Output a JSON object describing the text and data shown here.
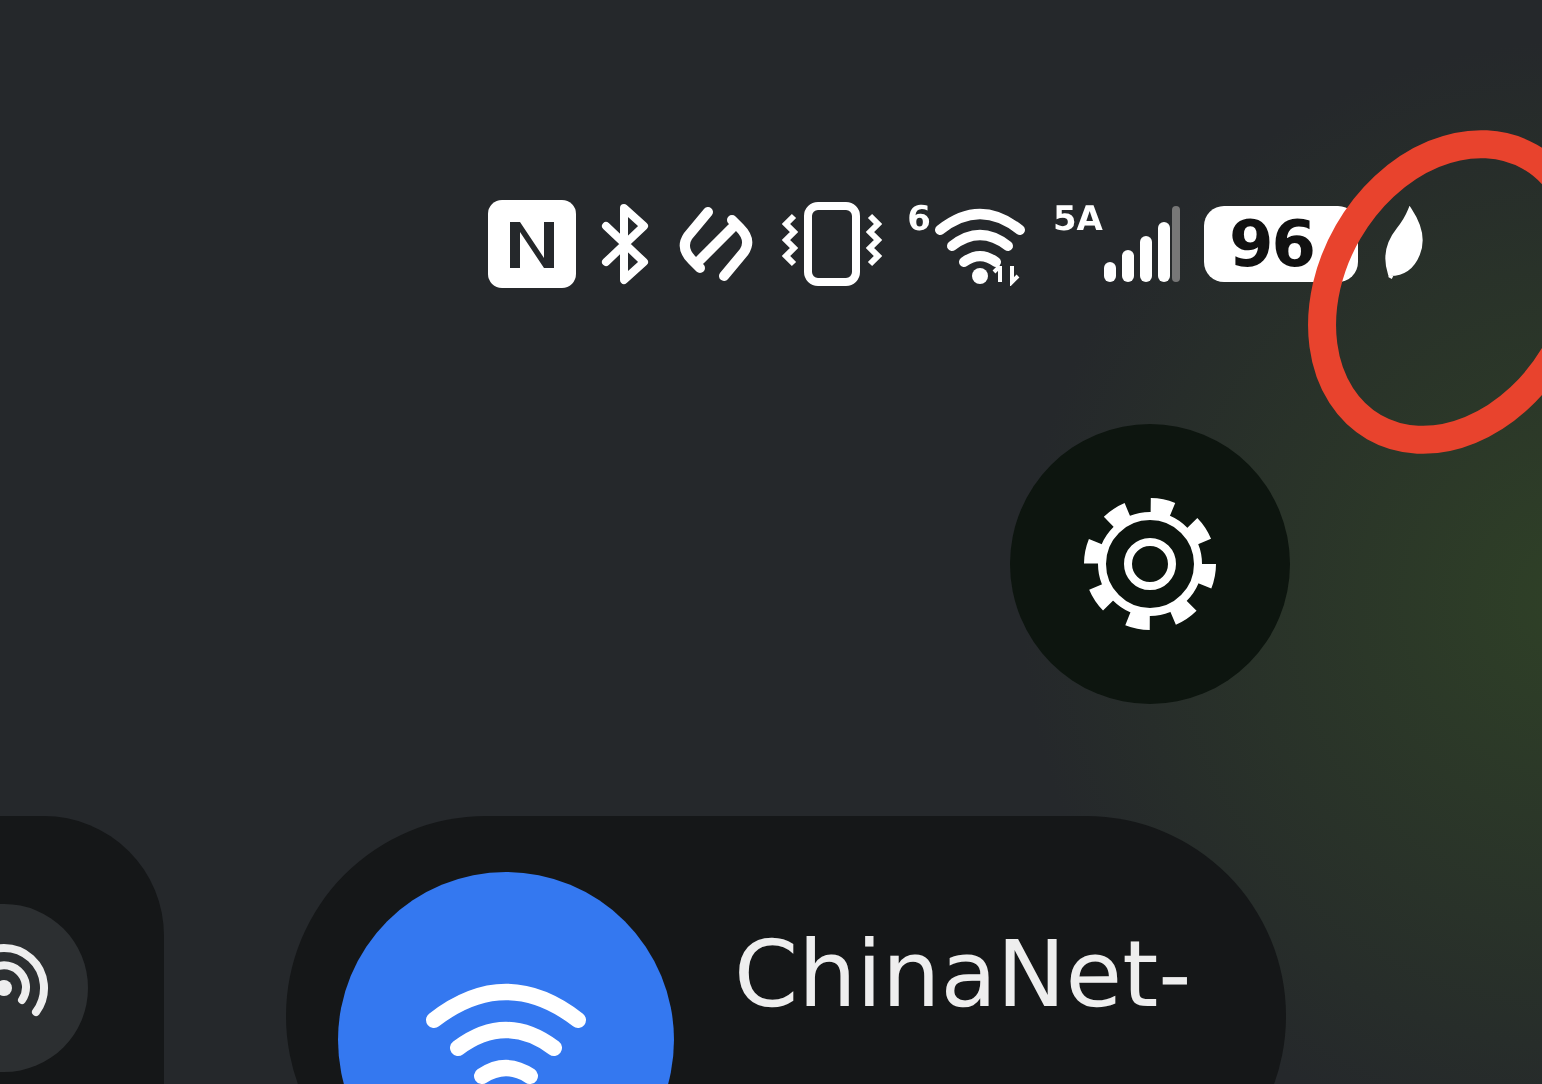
{
  "status_bar": {
    "wifi_standard": "6",
    "network_type": "5A",
    "battery": "96"
  },
  "wifi_tile": {
    "network_name": "ChinaNet-",
    "on": true
  }
}
